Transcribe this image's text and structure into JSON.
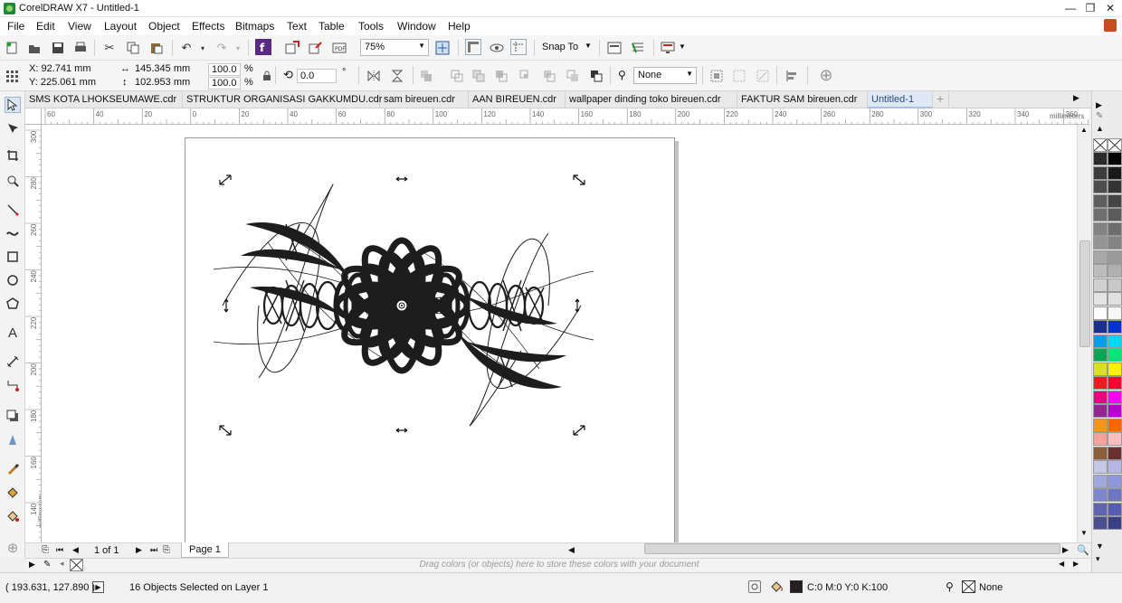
{
  "window": {
    "title": "CorelDRAW X7 - Untitled-1",
    "minimize": "—",
    "restore": "❐",
    "close": "✕"
  },
  "menu": [
    "File",
    "Edit",
    "View",
    "Layout",
    "Object",
    "Effects",
    "Bitmaps",
    "Text",
    "Table",
    "Tools",
    "Window",
    "Help"
  ],
  "toolbar": {
    "zoom_value": "75%",
    "snap_to_label": "Snap To"
  },
  "property_bar": {
    "x": "X: 92.741 mm",
    "y": "Y: 225.061 mm",
    "width": "145.345 mm",
    "height": "102.953 mm",
    "scale_x": "100.0",
    "scale_y": "100.0",
    "pct": "%",
    "rotation": "0.0",
    "degree": "°",
    "outline_width": "None"
  },
  "tabs": [
    {
      "label": "SMS KOTA LHOKSEUMAWE.cdr",
      "active": false
    },
    {
      "label": "STRUKTUR ORGANISASI GAKKUMDU.cdr",
      "active": false
    },
    {
      "label": "sam bireuen.cdr",
      "active": false
    },
    {
      "label": "AAN BIREUEN.cdr",
      "active": false
    },
    {
      "label": "wallpaper dinding toko bireuen.cdr",
      "active": false
    },
    {
      "label": "FAKTUR SAM bireuen.cdr",
      "active": false
    },
    {
      "label": "Untitled-1",
      "active": true
    }
  ],
  "add_tab": "+",
  "hruler": {
    "ticks": [
      "60",
      "40",
      "20",
      "0",
      "20",
      "40",
      "60",
      "80",
      "100",
      "120",
      "140",
      "160",
      "180",
      "200",
      "220",
      "240",
      "260",
      "280",
      "300",
      "320",
      "340",
      "360"
    ],
    "units": "millimeters"
  },
  "vruler": {
    "ticks": [
      "300",
      "280",
      "260",
      "240",
      "220",
      "200",
      "180",
      "160",
      "140"
    ],
    "units": "millimeters"
  },
  "page_nav": {
    "page_count": "1 of 1",
    "page_tab": "Page 1"
  },
  "color_dock_hint": "Drag colors (or objects) here to store these colors with your document",
  "palette": [
    [
      "#2b2b2b",
      "#000000"
    ],
    [
      "#3c3c3c",
      "#1a1a1a"
    ],
    [
      "#4d4d4d",
      "#333333"
    ],
    [
      "#5e5e5e",
      "#454545"
    ],
    [
      "#707070",
      "#5a5a5a"
    ],
    [
      "#828282",
      "#6e6e6e"
    ],
    [
      "#959595",
      "#848484"
    ],
    [
      "#a8a8a8",
      "#9a9a9a"
    ],
    [
      "#bcbcbc",
      "#b0b0b0"
    ],
    [
      "#d0d0d0",
      "#c8c8c8"
    ],
    [
      "#e4e4e4",
      "#e0e0e0"
    ],
    [
      "#ffffff",
      "#f6f6f6"
    ],
    [
      "#1c2f8f",
      "#0033cc"
    ],
    [
      "#00a0e9",
      "#00d8ff"
    ],
    [
      "#00a651",
      "#00e676"
    ],
    [
      "#d9e021",
      "#fff200"
    ],
    [
      "#ed1c24",
      "#ff0033"
    ],
    [
      "#e6007e",
      "#ff00ff"
    ],
    [
      "#92278f",
      "#b400c8"
    ],
    [
      "#f7941d",
      "#ff6600"
    ],
    [
      "#f9a19a",
      "#f8bdbd"
    ],
    [
      "#8b5e3c",
      "#6b2e2e"
    ],
    [
      "#c7c7e8",
      "#b5b5e6"
    ],
    [
      "#9fa7dc",
      "#8f96dd"
    ],
    [
      "#7f86cc",
      "#6f76c4"
    ],
    [
      "#5f63b0",
      "#565bb5"
    ],
    [
      "#4d4f93",
      "#3b3f8a"
    ]
  ],
  "status": {
    "cursor": "( 193.631, 127.890 )",
    "selection": "16 Objects Selected on Layer 1",
    "fill": "C:0 M:0 Y:0 K:100",
    "fill_color": "#231f20",
    "outline": "None"
  }
}
